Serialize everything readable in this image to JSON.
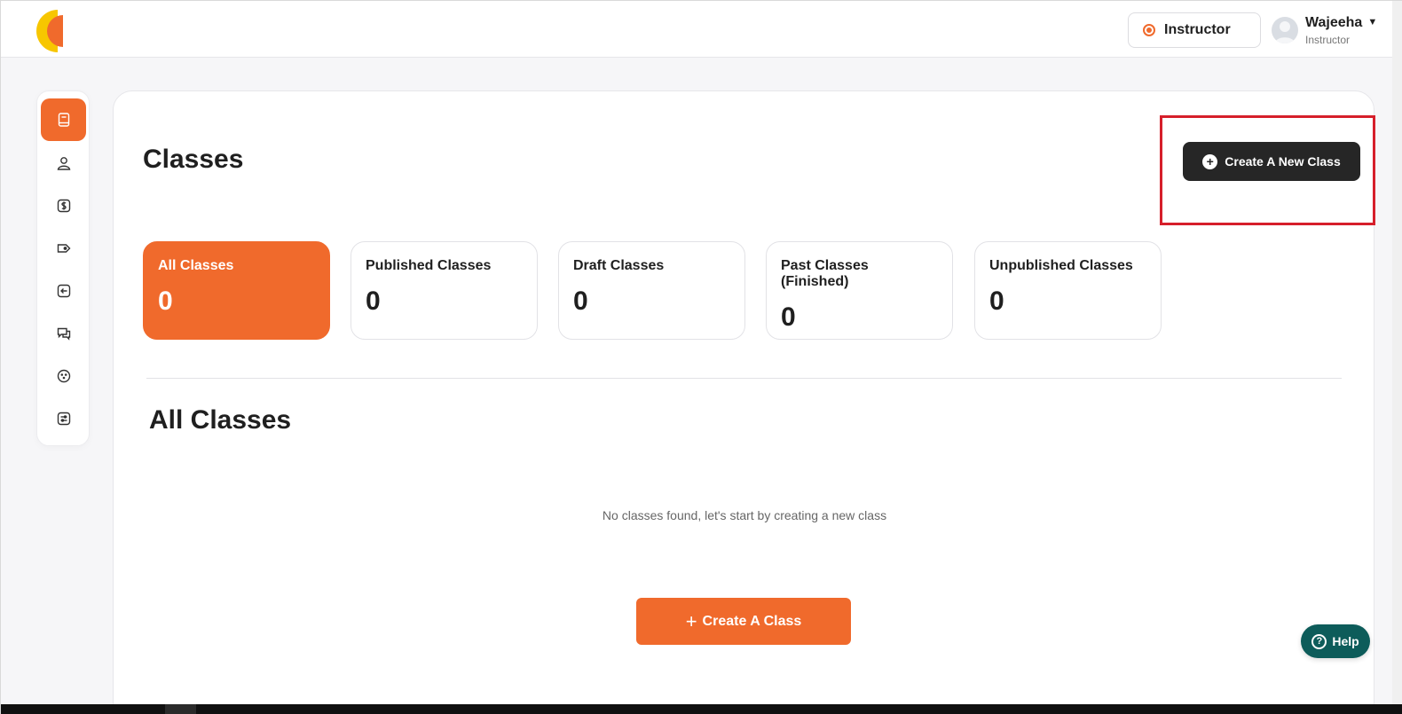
{
  "header": {
    "role_button_label": "Instructor",
    "user_name": "Wajeeha",
    "user_role": "Instructor"
  },
  "sidebar": {
    "items": [
      {
        "icon": "book-icon",
        "active": true
      },
      {
        "icon": "user-icon",
        "active": false
      },
      {
        "icon": "dollar-icon",
        "active": false
      },
      {
        "icon": "tag-icon",
        "active": false
      },
      {
        "icon": "login-arrow-icon",
        "active": false
      },
      {
        "icon": "chat-icon",
        "active": false
      },
      {
        "icon": "smiley-icon",
        "active": false
      },
      {
        "icon": "settings-list-icon",
        "active": false
      }
    ]
  },
  "main": {
    "page_title": "Classes",
    "new_class_button": "Create A New Class",
    "stats": [
      {
        "label": "All Classes",
        "value": "0"
      },
      {
        "label": "Published Classes",
        "value": "0"
      },
      {
        "label": "Draft Classes",
        "value": "0"
      },
      {
        "label": "Past Classes (Finished)",
        "value": "0"
      },
      {
        "label": "Unpublished Classes",
        "value": "0"
      }
    ],
    "section_title": "All Classes",
    "empty_message": "No classes found, let's start by creating a new class",
    "create_button": "Create A Class"
  },
  "help_button": "Help",
  "colors": {
    "accent": "#f06a2c",
    "dark_button": "#262626",
    "help": "#0d5c5a",
    "highlight": "#d61f2b"
  }
}
